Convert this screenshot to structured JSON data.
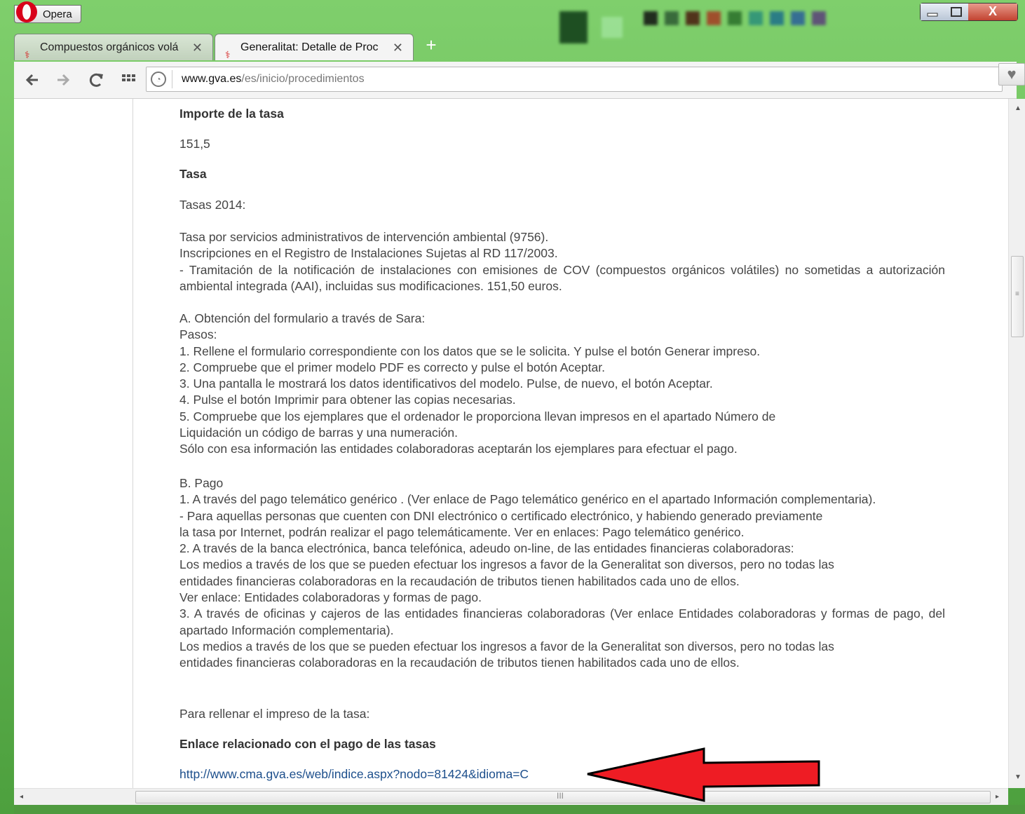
{
  "browser": {
    "menu_label": "Opera",
    "tabs": [
      {
        "title": "Compuestos orgánicos volá",
        "close": "✕"
      },
      {
        "title": "Generalitat: Detalle de Proc",
        "close": "✕"
      }
    ],
    "new_tab": "+",
    "address": {
      "domain": "www.gva.es",
      "path": "/es/inicio/procedimientos"
    },
    "win_close": "X"
  },
  "page": {
    "importe_heading": "Importe de la tasa",
    "importe_value": "151,5",
    "tasa_heading": "Tasa",
    "tasas_year": "Tasas 2014:",
    "block1": [
      "Tasa por servicios administrativos de intervención ambiental (9756).",
      "Inscripciones en el Registro de Instalaciones Sujetas al RD 117/2003.",
      "- Tramitación de la notificación de instalaciones con emisiones de COV (compuestos orgánicos volátiles) no sometidas a autorización ambiental integrada (AAI), incluidas sus modificaciones. 151,50 euros."
    ],
    "block2": [
      "A. Obtención del formulario a través de Sara:",
      "Pasos:",
      "1. Rellene el formulario correspondiente con los datos que se le solicita. Y pulse el botón Generar impreso.",
      "2. Compruebe que el primer modelo PDF es correcto y pulse el botón Aceptar.",
      "3. Una pantalla le mostrará los datos identificativos del modelo. Pulse, de nuevo, el botón Aceptar.",
      "4. Pulse el botón Imprimir para obtener las copias necesarias.",
      "5. Compruebe que los ejemplares que el ordenador le proporciona llevan impresos en el apartado Número de",
      "Liquidación un código de barras y una numeración.",
      "Sólo con esa información las entidades colaboradoras aceptarán los ejemplares para efectuar el pago."
    ],
    "block3_title": "B. Pago",
    "block3_item1": "1. A través del pago telemático genérico . (Ver enlace de Pago telemático genérico en el apartado Información complementaria).",
    "block3": [
      "- Para aquellas personas que cuenten con DNI electrónico o certificado electrónico, y habiendo generado previamente",
      "la tasa por Internet, podrán realizar el pago telemáticamente. Ver en enlaces: Pago telemático genérico.",
      "2. A través de la banca electrónica, banca telefónica, adeudo on-line, de las entidades financieras colaboradoras:",
      "Los medios a través de los que se pueden efectuar los ingresos a favor de la Generalitat son diversos, pero no todas las",
      "entidades financieras colaboradoras en la recaudación de tributos tienen habilitados cada uno de ellos.",
      "Ver enlace: Entidades colaboradoras y formas de pago."
    ],
    "block3_item3": "3. A través de oficinas y cajeros de las entidades financieras colaboradoras (Ver enlace Entidades colaboradoras y formas de pago, del apartado Información complementaria).",
    "block3_end": [
      "Los medios a través de los que se pueden efectuar los ingresos a favor de la Generalitat son diversos, pero no todas las",
      "entidades financieras colaboradoras en la recaudación de tributos tienen habilitados cada uno de ellos."
    ],
    "rellenar": "Para rellenar el impreso de la tasa:",
    "enlace_heading": "Enlace relacionado con el pago de las tasas",
    "enlace_url": "http://www.cma.gva.es/web/indice.aspx?nodo=81424&idioma=C"
  },
  "colors": {
    "arrow": "#ee1c24",
    "link": "#1d4f8c",
    "text": "#454545"
  },
  "icons": {
    "back": "arrow-left-icon",
    "forward": "arrow-right-icon",
    "reload": "reload-icon",
    "speed_dial": "grid-icon",
    "site": "site-info-icon",
    "bookmark": "heart-icon"
  }
}
